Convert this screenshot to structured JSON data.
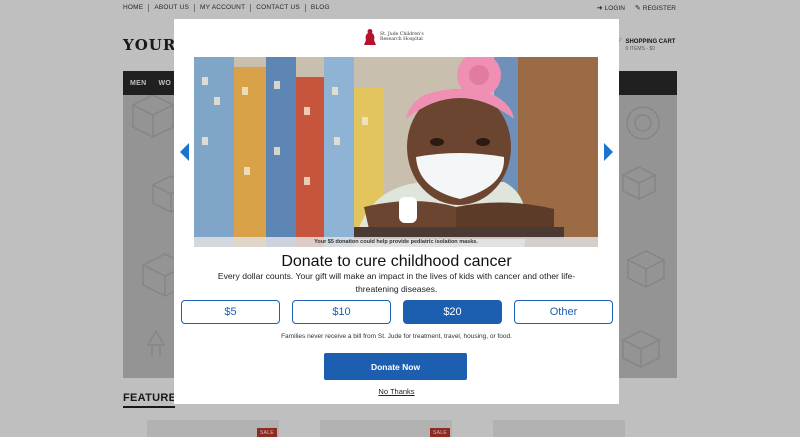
{
  "top_nav": {
    "items": [
      "HOME",
      "ABOUT US",
      "MY ACCOUNT",
      "CONTACT US",
      "BLOG"
    ],
    "login": "LOGIN",
    "register": "REGISTER"
  },
  "header": {
    "brand": "YOUR L",
    "cart_title": "SHOPPING CART",
    "cart_sub": "0 ITEMS - $0"
  },
  "main_nav": {
    "items": [
      "MEN",
      "WO"
    ]
  },
  "featured": {
    "title": "FEATURE",
    "sale_badge": "SALE"
  },
  "modal": {
    "logo_text_line1": "St. Jude Children's",
    "logo_text_line2": "Research Hospital",
    "photo_caption": "Your $5 donation could help provide pediatric isolation masks.",
    "headline": "Donate to cure childhood cancer",
    "subtext": "Every dollar counts. Your gift will make an impact in the lives of kids with cancer and other life-threatening diseases.",
    "amounts": [
      {
        "label": "$5",
        "selected": false
      },
      {
        "label": "$10",
        "selected": false
      },
      {
        "label": "$20",
        "selected": true
      },
      {
        "label": "Other",
        "selected": false
      }
    ],
    "note": "Families never receive a bill from St. Jude for treatment, travel, housing, or food.",
    "donate_label": "Donate Now",
    "no_thanks": "No Thanks"
  },
  "colors": {
    "accent": "#1c5fb0",
    "arrow": "#1a73d1",
    "logo_red": "#b5122e",
    "nav_bg": "#2b2b2b",
    "sale": "#c0392b"
  },
  "icons": [
    "login-icon",
    "register-icon",
    "cart-icon",
    "prev-arrow-icon",
    "next-arrow-icon",
    "st-jude-logo-icon"
  ]
}
